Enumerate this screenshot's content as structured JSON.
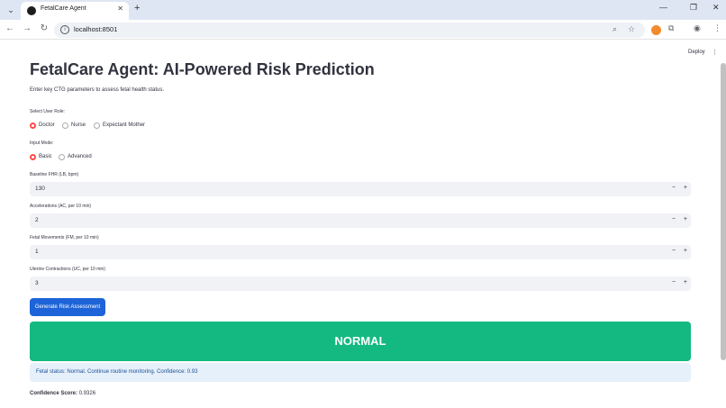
{
  "browser": {
    "tab_title": "FetalCare Agent",
    "url": "localhost:8501"
  },
  "app": {
    "deploy_label": "Deploy",
    "title": "FetalCare Agent: AI-Powered Risk Prediction",
    "subtitle": "Enter key CTG parameters to assess fetal health status."
  },
  "user_role": {
    "label": "Select User Role:",
    "options": [
      "Doctor",
      "Nurse",
      "Expectant Mother"
    ],
    "selected": "Doctor"
  },
  "input_mode": {
    "label": "Input Mode:",
    "options": [
      "Basic",
      "Advanced"
    ],
    "selected": "Basic"
  },
  "inputs": [
    {
      "label": "Baseline FHR (LB, bpm)",
      "value": "130"
    },
    {
      "label": "Accelerations (AC, per 10 min)",
      "value": "2"
    },
    {
      "label": "Fetal Movements (FM, per 10 min)",
      "value": "1"
    },
    {
      "label": "Uterine Contractions (UC, per 10 min)",
      "value": "3"
    }
  ],
  "generate_button": "Generate Risk Assessment",
  "result": {
    "status": "NORMAL",
    "status_color": "#13b981",
    "message": "Fetal status: Normal. Continue routine monitoring. Confidence: 0.93",
    "confidence_label": "Confidence Score:",
    "confidence_value": "0.9326"
  },
  "colors": {
    "accent": "#ff4b4b",
    "button": "#1d64d8"
  }
}
